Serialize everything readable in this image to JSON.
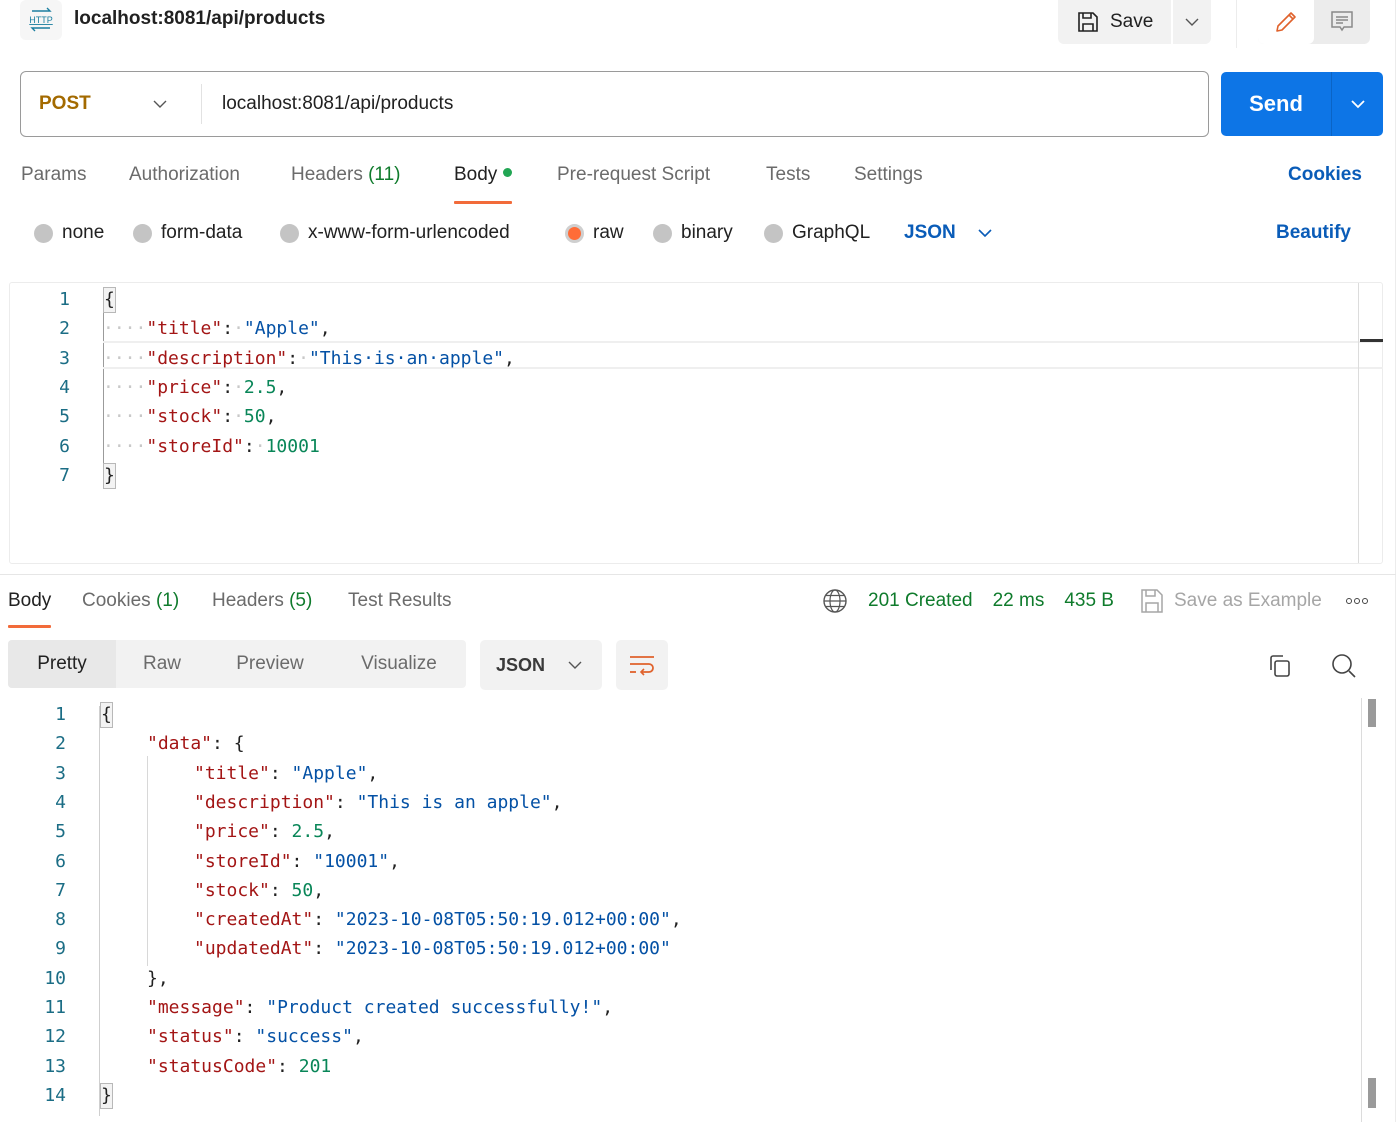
{
  "request": {
    "title": "localhost:8081/api/products",
    "save_label": "Save",
    "method": "POST",
    "url": "localhost:8081/api/products",
    "send_label": "Send",
    "tabs": [
      {
        "label": "Params"
      },
      {
        "label": "Authorization"
      },
      {
        "label": "Headers",
        "count": "(11)"
      },
      {
        "label": "Body",
        "active": true
      },
      {
        "label": "Pre-request Script"
      },
      {
        "label": "Tests"
      },
      {
        "label": "Settings"
      }
    ],
    "cookies_label": "Cookies",
    "body_types": [
      {
        "label": "none"
      },
      {
        "label": "form-data"
      },
      {
        "label": "x-www-form-urlencoded"
      },
      {
        "label": "raw",
        "checked": true
      },
      {
        "label": "binary"
      },
      {
        "label": "GraphQL"
      }
    ],
    "body_language": "JSON",
    "beautify_label": "Beautify",
    "body_lines": [
      {
        "n": "1",
        "text": "{"
      },
      {
        "n": "2",
        "key": "\"title\"",
        "value": "\"Apple\"",
        "vtype": "s",
        "trail": ","
      },
      {
        "n": "3",
        "key": "\"description\"",
        "value": "\"This is an apple\"",
        "vtype": "s",
        "trail": ","
      },
      {
        "n": "4",
        "key": "\"price\"",
        "value": "2.5",
        "vtype": "n",
        "trail": ","
      },
      {
        "n": "5",
        "key": "\"stock\"",
        "value": "50",
        "vtype": "n",
        "trail": ","
      },
      {
        "n": "6",
        "key": "\"storeId\"",
        "value": "10001",
        "vtype": "n",
        "trail": ""
      },
      {
        "n": "7",
        "text": "}"
      }
    ]
  },
  "response": {
    "tabs": [
      {
        "label": "Body",
        "active": true
      },
      {
        "label": "Cookies",
        "count": "(1)"
      },
      {
        "label": "Headers",
        "count": "(5)"
      },
      {
        "label": "Test Results"
      }
    ],
    "status": "201 Created",
    "time": "22 ms",
    "size": "435 B",
    "save_example_label": "Save as Example",
    "views": [
      "Pretty",
      "Raw",
      "Preview",
      "Visualize"
    ],
    "active_view": "Pretty",
    "language": "JSON",
    "lines": [
      {
        "n": "1",
        "indent": 0,
        "text": "{"
      },
      {
        "n": "2",
        "indent": 1,
        "key": "\"data\"",
        "raw": "{"
      },
      {
        "n": "3",
        "indent": 2,
        "key": "\"title\"",
        "value": "\"Apple\"",
        "vtype": "s",
        "trail": ","
      },
      {
        "n": "4",
        "indent": 2,
        "key": "\"description\"",
        "value": "\"This is an apple\"",
        "vtype": "s",
        "trail": ","
      },
      {
        "n": "5",
        "indent": 2,
        "key": "\"price\"",
        "value": "2.5",
        "vtype": "n",
        "trail": ","
      },
      {
        "n": "6",
        "indent": 2,
        "key": "\"storeId\"",
        "value": "\"10001\"",
        "vtype": "s",
        "trail": ","
      },
      {
        "n": "7",
        "indent": 2,
        "key": "\"stock\"",
        "value": "50",
        "vtype": "n",
        "trail": ","
      },
      {
        "n": "8",
        "indent": 2,
        "key": "\"createdAt\"",
        "value": "\"2023-10-08T05:50:19.012+00:00\"",
        "vtype": "s",
        "trail": ","
      },
      {
        "n": "9",
        "indent": 2,
        "key": "\"updatedAt\"",
        "value": "\"2023-10-08T05:50:19.012+00:00\"",
        "vtype": "s",
        "trail": ""
      },
      {
        "n": "10",
        "indent": 1,
        "text": "},"
      },
      {
        "n": "11",
        "indent": 1,
        "key": "\"message\"",
        "value": "\"Product created successfully!\"",
        "vtype": "s",
        "trail": ","
      },
      {
        "n": "12",
        "indent": 1,
        "key": "\"status\"",
        "value": "\"success\"",
        "vtype": "s",
        "trail": ","
      },
      {
        "n": "13",
        "indent": 1,
        "key": "\"statusCode\"",
        "value": "201",
        "vtype": "n",
        "trail": ""
      },
      {
        "n": "14",
        "indent": 0,
        "text": "}"
      }
    ]
  },
  "icons": {
    "http": "http-icon",
    "save": "floppy-disk-icon",
    "edit": "pencil-icon",
    "comments": "comment-icon",
    "globe": "globe-icon",
    "wrap": "wrap-lines-icon",
    "copy": "copy-icon",
    "search": "search-icon",
    "more": "more-horizontal-icon"
  },
  "colors": {
    "accent": "#ff6c37",
    "send": "#0d75e6",
    "link": "#0a5cb8",
    "status_ok": "#0f7b2c",
    "method_post": "#a36a00"
  }
}
